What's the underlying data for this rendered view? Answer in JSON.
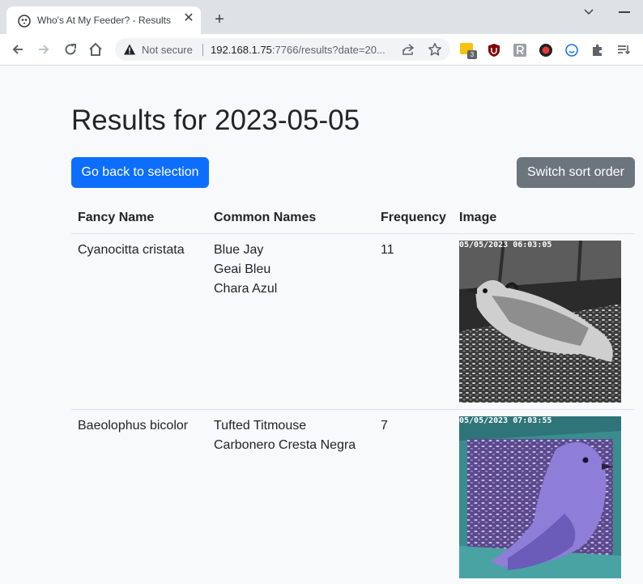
{
  "browser": {
    "tab_title": "Who's At My Feeder? - Results",
    "close_glyph": "✕",
    "new_tab_glyph": "+",
    "security_label": "Not secure",
    "url_host": "192.168.1.75",
    "url_rest": ":7766/results?date=20...",
    "extension_badge": "3"
  },
  "page": {
    "title": "Results for 2023-05-05",
    "back_button": "Go back to selection",
    "sort_button": "Switch sort order"
  },
  "table": {
    "headers": [
      "Fancy Name",
      "Common Names",
      "Frequency",
      "Image"
    ],
    "rows": [
      {
        "fancy_name": "Cyanocitta cristata",
        "common_names": [
          "Blue Jay",
          "Geai Bleu",
          "Chara Azul"
        ],
        "frequency": "11",
        "image_timestamp": "05/05/2023 06:03:05"
      },
      {
        "fancy_name": "Baeolophus bicolor",
        "common_names": [
          "Tufted Titmouse",
          "Carbonero Cresta Negra"
        ],
        "frequency": "7",
        "image_timestamp": "05/05/2023 07:03:55"
      }
    ]
  },
  "icons": {
    "favicon": "bird-icon",
    "back": "arrow-left-icon",
    "forward": "arrow-right-icon",
    "reload": "reload-icon",
    "home": "home-icon",
    "security": "warning-icon",
    "share": "share-icon",
    "bookmark": "star-icon",
    "extensions": "puzzle-icon",
    "reading_list": "reading-list-icon"
  },
  "colors": {
    "primary": "#0d6efd",
    "secondary": "#6c757d",
    "page_bg": "#f8f9fa"
  }
}
